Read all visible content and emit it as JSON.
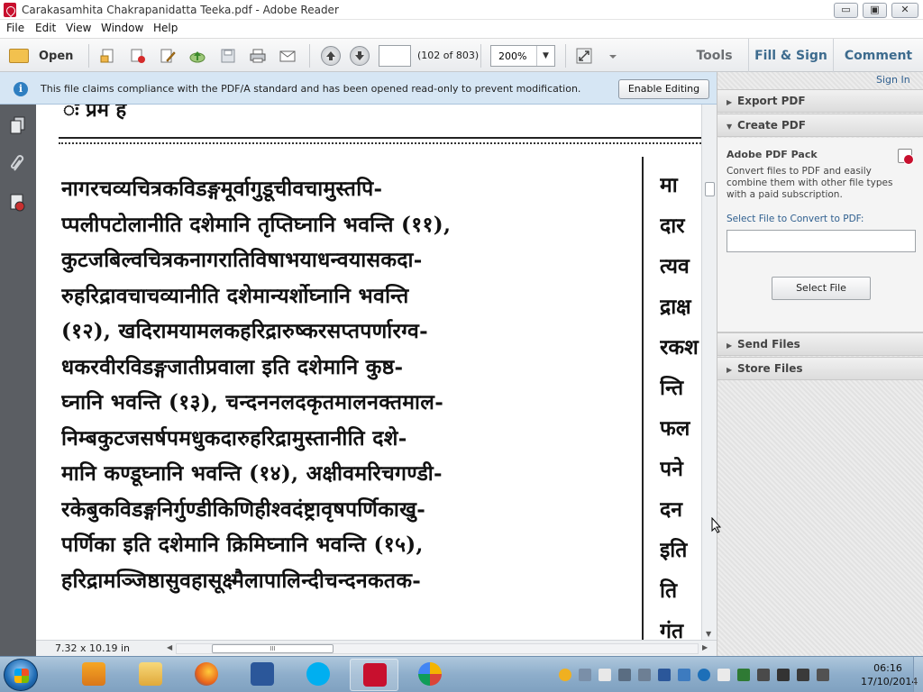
{
  "window": {
    "title": "Carakasamhita Chakrapanidatta Teeka.pdf - Adobe Reader",
    "controls": {
      "minimize": "▭",
      "maximize": "▣",
      "close": "✕"
    }
  },
  "menu": [
    "File",
    "Edit",
    "View",
    "Window",
    "Help"
  ],
  "toolbar": {
    "open_label": "Open",
    "page_input": "",
    "page_count": "(102 of 803)",
    "zoom": "200%",
    "tabs": {
      "tools": "Tools",
      "fill_sign": "Fill & Sign",
      "comment": "Comment"
    }
  },
  "infobar": {
    "message": "This file claims compliance with the PDF/A standard and has been opened read-only to prevent modification.",
    "button": "Enable Editing"
  },
  "document": {
    "top_fragment": "ः प्रमं  ह",
    "lines": [
      "नागरचव्यचित्रकविडङ्गमूर्वागुडूचीवचामुस्तपि-",
      "प्पलीपटोलानीति दशेमानि तृप्तिघ्नानि भवन्ति (११),",
      "कुटजबिल्वचित्रकनागरातिविषाभयाधन्वयासकदा-",
      "रुहरिद्रावचाचव्यानीति   दशेमान्यर्शोघ्नानि भवन्ति",
      "(१२), खदिरामयामलकहरिद्रारुष्करसप्तपर्णारग्व-",
      "धकरवीरविडङ्गजातीप्रवाला इति दशेमानि कुष्ठ-",
      "घ्नानि भवन्ति (१३), चन्दननलदकृतमालनक्तमाल-",
      "निम्बकुटजसर्षपमधुकदारुहरिद्रामुस्तानीति  दशे-",
      "मानि कण्डूघ्नानि भवन्ति (१४), अक्षीवमरिचगण्डी-",
      "रकेबुकविडङ्गनिर्गुण्डीकिणिहीश्वदंष्ट्रावृषपर्णिकाखु-",
      "पर्णिका इति दशेमानि  क्रिमिघ्नानि  भवन्ति (१५),",
      "हरिद्रामञ्जिष्ठासुवहासूक्ष्मैलापालिन्दीचन्दनकतक-"
    ],
    "right_column": [
      "मा",
      "दार",
      "त्यव",
      "द्राक्ष",
      "रकश",
      "न्ति",
      "फल",
      "पने",
      "दन",
      "इति",
      "ति",
      "गंत"
    ]
  },
  "status": {
    "dimensions": "7.32 x 10.19 in",
    "hscroll_grip": "III"
  },
  "panel": {
    "sign_in": "Sign In",
    "export_pdf": "Export PDF",
    "create_pdf": "Create PDF",
    "pack_title": "Adobe PDF Pack",
    "pack_desc": "Convert files to PDF and easily combine them with other file types with a paid subscription.",
    "select_label": "Select File to Convert to PDF:",
    "select_button": "Select File",
    "send_files": "Send Files",
    "store_files": "Store Files"
  },
  "taskbar": {
    "apps": [
      "media-player",
      "explorer",
      "firefox",
      "word",
      "skype",
      "adobe-reader",
      "picasa"
    ],
    "time": "06:16",
    "date": "17/10/2014"
  },
  "colors": {
    "accent_blue": "#3d6b8e",
    "infobar": "#d6e6f4",
    "leftnav": "#5b5e63",
    "taskbar": "#8eaecb"
  }
}
